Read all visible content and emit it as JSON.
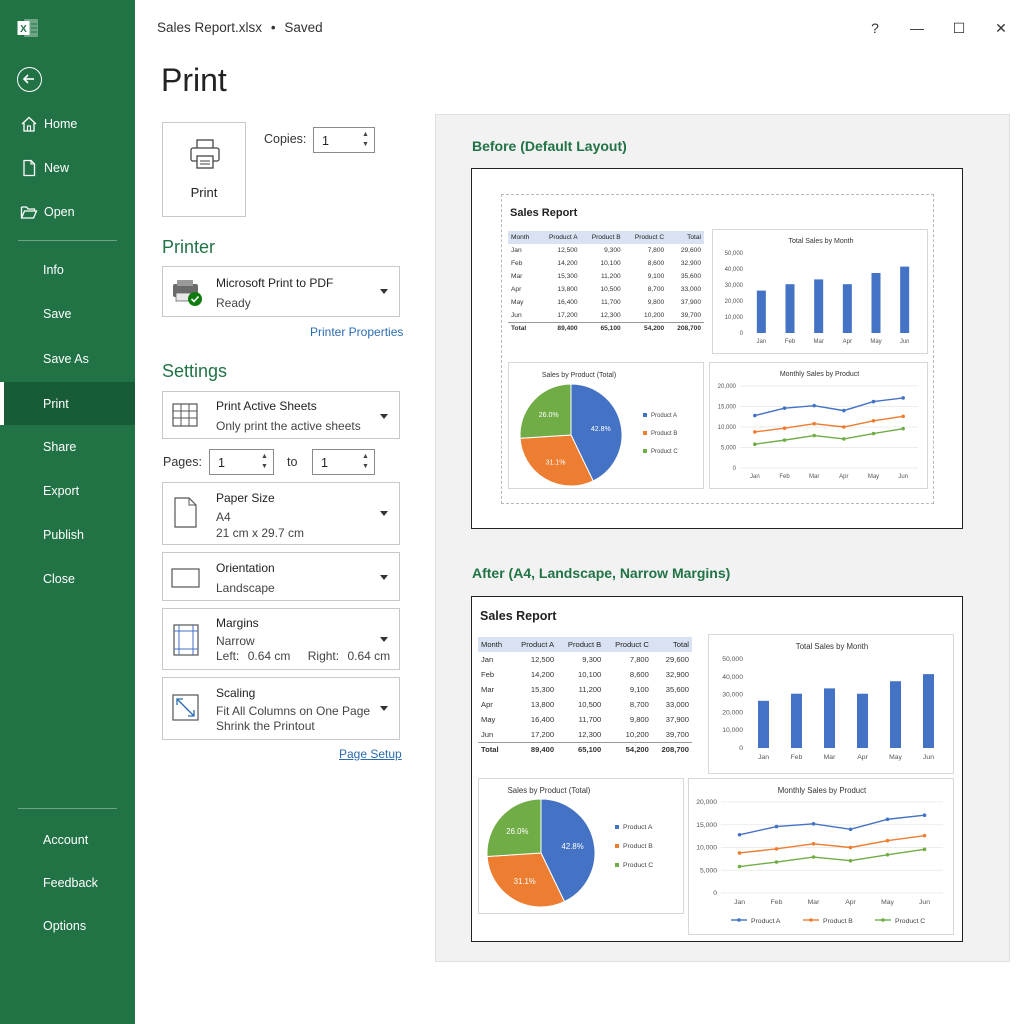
{
  "window": {
    "title": "Sales Report.xlsx",
    "separator": "•",
    "status": "Saved",
    "help": "?",
    "minimize": "—",
    "maximize": "☐",
    "close": "✕"
  },
  "sidebar": {
    "top_items": [
      {
        "label": "Home",
        "icon": "home-icon"
      },
      {
        "label": "New",
        "icon": "new-document-icon"
      },
      {
        "label": "Open",
        "icon": "folder-open-icon"
      }
    ],
    "middle_items": [
      {
        "label": "Info"
      },
      {
        "label": "Save"
      },
      {
        "label": "Save As"
      },
      {
        "label": "Print",
        "active": true
      },
      {
        "label": "Share"
      },
      {
        "label": "Export"
      },
      {
        "label": "Publish"
      },
      {
        "label": "Close"
      }
    ],
    "bottom_items": [
      {
        "label": "Account"
      },
      {
        "label": "Feedback"
      },
      {
        "label": "Options"
      }
    ],
    "logo": "excel-logo-icon",
    "logo_letter": "X"
  },
  "print": {
    "page_title": "Print",
    "button_label": "Print",
    "copies_label": "Copies:",
    "copies_value": "1",
    "printer_heading": "Printer",
    "printer_name": "Microsoft Print to PDF",
    "printer_status": "Ready",
    "printer_properties": "Printer Properties",
    "settings_heading": "Settings",
    "sheets_title": "Print Active Sheets",
    "sheets_desc": "Only print the active sheets",
    "pages_label": "Pages:",
    "pages_from": "1",
    "pages_to_label": "to",
    "pages_to": "1",
    "paper_title": "Paper Size",
    "paper_value": "A4",
    "paper_dims": "21 cm x 29.7 cm",
    "orientation_title": "Orientation",
    "orientation_value": "Landscape",
    "margins_title": "Margins",
    "margins_value": "Narrow",
    "margins_left_label": "Left:",
    "margins_left": "0.64 cm",
    "margins_right_label": "Right:",
    "margins_right": "0.64 cm",
    "scaling_title": "Scaling",
    "scaling_value": "Fit All Columns on One Page",
    "scaling_desc": "Shrink the Printout",
    "page_setup": "Page Setup"
  },
  "preview": {
    "before_heading": "Before (Default Layout)",
    "after_heading": "After (A4, Landscape, Narrow Margins)",
    "report_title": "Sales Report",
    "table": {
      "headers": [
        "Month",
        "Product A",
        "Product B",
        "Product C",
        "Total"
      ],
      "rows": [
        [
          "Jan",
          "12,500",
          "9,300",
          "7,800",
          "29,600"
        ],
        [
          "Feb",
          "14,200",
          "10,100",
          "8,600",
          "32,900"
        ],
        [
          "Mar",
          "15,300",
          "11,200",
          "9,100",
          "35,600"
        ],
        [
          "Apr",
          "13,800",
          "10,500",
          "8,700",
          "33,000"
        ],
        [
          "May",
          "16,400",
          "11,700",
          "9,800",
          "37,900"
        ],
        [
          "Jun",
          "17,200",
          "12,300",
          "10,200",
          "39,700"
        ]
      ],
      "total": [
        "Total",
        "89,400",
        "65,100",
        "54,200",
        "208,700"
      ]
    },
    "colors": {
      "product_a": "#4472c4",
      "product_b": "#ed7d31",
      "product_c": "#70ad47",
      "bar": "#4472c4"
    }
  },
  "chart_data": [
    {
      "type": "bar",
      "title": "Total Sales by Month",
      "categories": [
        "Jan",
        "Feb",
        "Mar",
        "Apr",
        "May",
        "Jun"
      ],
      "values": [
        26500,
        30500,
        33500,
        30500,
        37500,
        41500
      ],
      "ylim": [
        0,
        50000
      ],
      "yticks": [
        "0",
        "10,000",
        "20,000",
        "30,000",
        "40,000",
        "50,000"
      ]
    },
    {
      "type": "pie",
      "title": "Sales by Product (Total)",
      "categories": [
        "Product A",
        "Product B",
        "Product C"
      ],
      "values": [
        42.8,
        31.1,
        26.0
      ],
      "labels": [
        "42.8%",
        "31.1%",
        "26.0%"
      ],
      "legend": "right"
    },
    {
      "type": "line",
      "title": "Monthly Sales by Product",
      "categories": [
        "Jan",
        "Feb",
        "Mar",
        "Apr",
        "May",
        "Jun"
      ],
      "series": [
        {
          "name": "Product A",
          "values": [
            12800,
            14600,
            15200,
            14000,
            16200,
            17100
          ]
        },
        {
          "name": "Product B",
          "values": [
            8800,
            9700,
            10800,
            10000,
            11500,
            12600
          ]
        },
        {
          "name": "Product C",
          "values": [
            5800,
            6800,
            7900,
            7100,
            8400,
            9600
          ]
        }
      ],
      "ylim": [
        0,
        20000
      ],
      "yticks": [
        "0",
        "5,000",
        "10,000",
        "15,000",
        "20,000"
      ]
    }
  ]
}
